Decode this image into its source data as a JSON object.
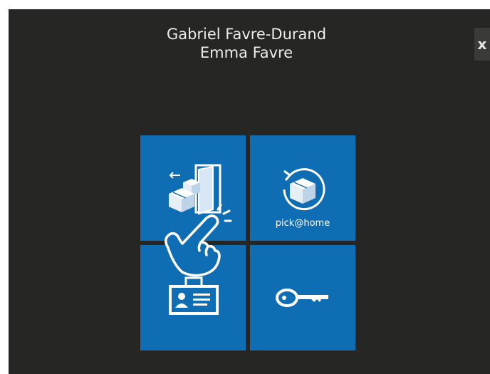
{
  "recipients": {
    "line1": "Gabriel Favre-Durand",
    "line2": "Emma Favre"
  },
  "close_button": {
    "icon": "close-icon",
    "label": "x"
  },
  "tiles": [
    {
      "id": "drop-off",
      "icon": "parcel-door-icon",
      "label": ""
    },
    {
      "id": "pick-at-home",
      "icon": "parcel-return-icon",
      "label": "pick@home"
    },
    {
      "id": "identification",
      "icon": "id-badge-icon",
      "label": ""
    },
    {
      "id": "key",
      "icon": "key-icon",
      "label": ""
    }
  ],
  "overlay": {
    "icon": "tap-hand-icon"
  },
  "colors": {
    "background": "#262624",
    "tile": "#0f6db3",
    "text": "#ececec"
  }
}
